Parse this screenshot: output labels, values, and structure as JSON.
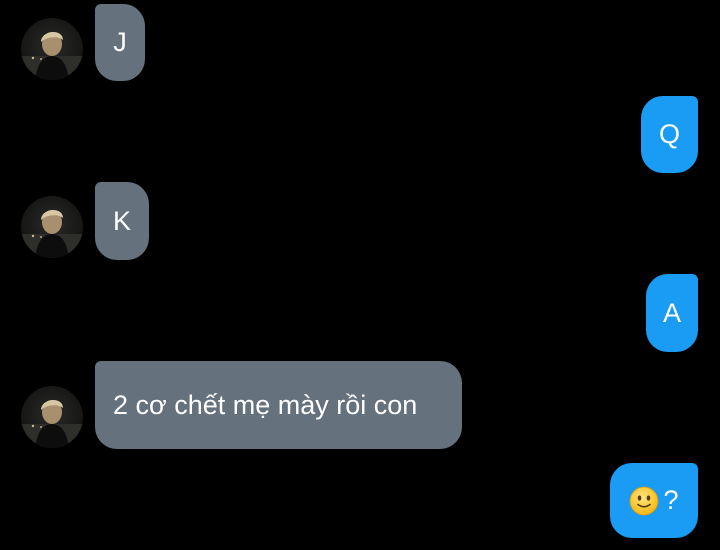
{
  "conversation": {
    "messages": [
      {
        "side": "incoming",
        "text": "J"
      },
      {
        "side": "outgoing",
        "text": "Q"
      },
      {
        "side": "incoming",
        "text": "K"
      },
      {
        "side": "outgoing",
        "text": "A"
      },
      {
        "side": "incoming",
        "text": "2 cơ chết mẹ mày rồi con"
      },
      {
        "side": "outgoing",
        "emoji": "slightly-smiling-face-icon",
        "text": "?"
      }
    ]
  },
  "colors": {
    "background": "#000000",
    "incoming_bubble": "#65717d",
    "outgoing_bubble": "#1b9cf4",
    "text": "#ffffff"
  }
}
